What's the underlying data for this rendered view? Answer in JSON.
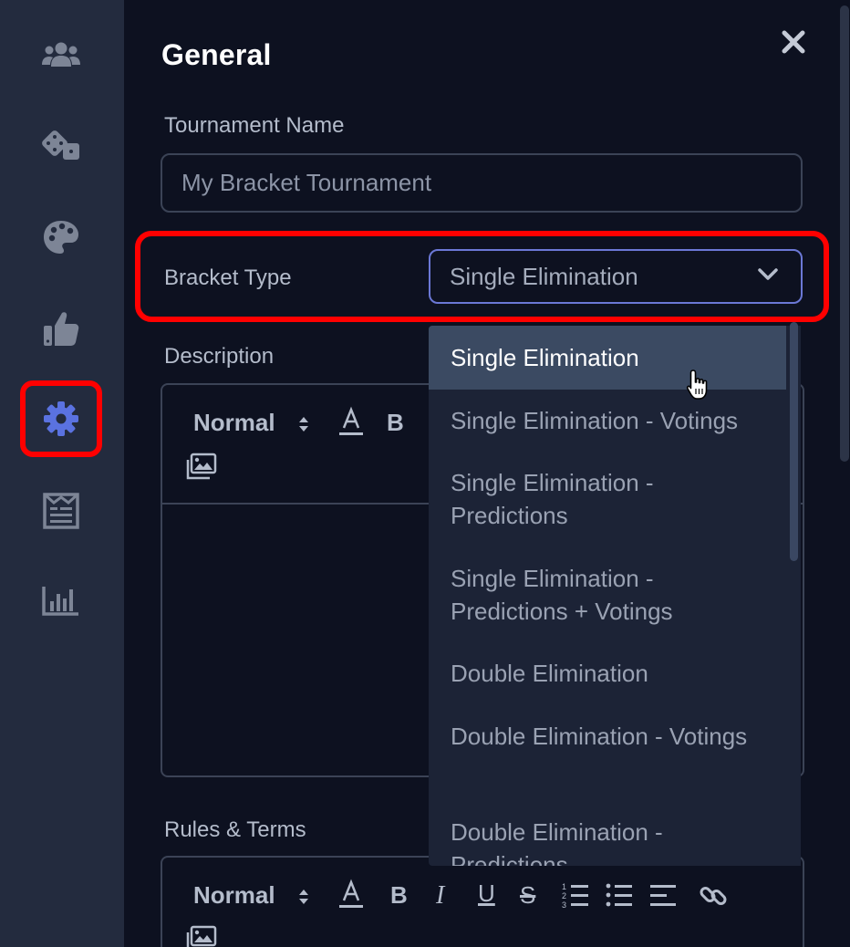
{
  "sidebar": {
    "items": [
      {
        "icon": "users-icon",
        "active": false
      },
      {
        "icon": "dice-icon",
        "active": false
      },
      {
        "icon": "palette-icon",
        "active": false
      },
      {
        "icon": "thumbs-up-icon",
        "active": false
      },
      {
        "icon": "gear-icon",
        "active": true
      },
      {
        "icon": "newspaper-icon",
        "active": false
      },
      {
        "icon": "chart-bar-icon",
        "active": false
      }
    ],
    "inactive_color": "#7d8596",
    "active_color": "#5a72e0",
    "highlight_color": "#ff0000"
  },
  "panel": {
    "title": "General",
    "close_icon": "close-icon"
  },
  "form": {
    "tournament_name_label": "Tournament Name",
    "tournament_name_value": "My Bracket Tournament",
    "bracket_type_label": "Bracket Type",
    "bracket_type_value": "Single Elimination",
    "description_label": "Description",
    "rules_label": "Rules & Terms"
  },
  "editor_toolbar": {
    "format_label": "Normal",
    "bold_label": "B",
    "italic_label": "I",
    "underline_label": "U",
    "strike_label": "S",
    "color_label": "A"
  },
  "dropdown": {
    "options": [
      "Single Elimination",
      "Single Elimination - Votings",
      "Single Elimination - Predictions",
      "Single Elimination - Predictions + Votings",
      "Double Elimination",
      "Double Elimination - Votings",
      "Double Elimination - Predictions"
    ],
    "selected_index": 0
  }
}
